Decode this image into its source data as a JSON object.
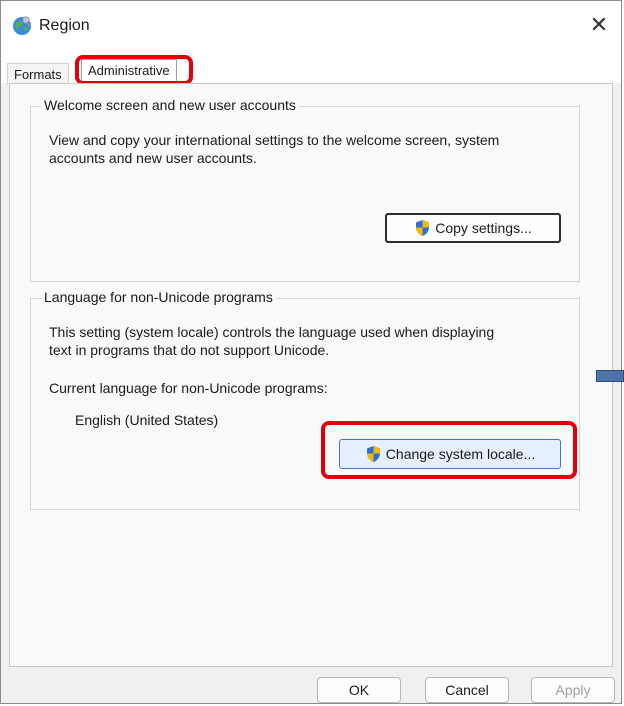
{
  "window": {
    "title": "Region",
    "close_glyph": "✕",
    "app_icon": "globe-icon"
  },
  "tabs": [
    {
      "label": "Formats",
      "selected": false
    },
    {
      "label": "Administrative",
      "selected": true
    }
  ],
  "welcome_group": {
    "title": "Welcome screen and new user accounts",
    "description_line1": "View and copy your international settings to the welcome screen, system",
    "description_line2": "accounts and new user accounts.",
    "button_label": "Copy settings...",
    "button_icon": "shield-icon"
  },
  "nonunicode_group": {
    "title": "Language for non-Unicode programs",
    "description_line1": "This setting (system locale) controls the language used when displaying",
    "description_line2": "text in programs that do not support Unicode.",
    "current_label": "Current language for non-Unicode programs:",
    "current_value": "English (United States)",
    "button_label": "Change system locale...",
    "button_icon": "shield-icon"
  },
  "footer": {
    "ok_label": "OK",
    "cancel_label": "Cancel",
    "apply_label": "Apply"
  },
  "colors": {
    "highlight": "#e0000a",
    "locale_button_border": "#3d78c8",
    "locale_button_fill": "#e6efff"
  }
}
